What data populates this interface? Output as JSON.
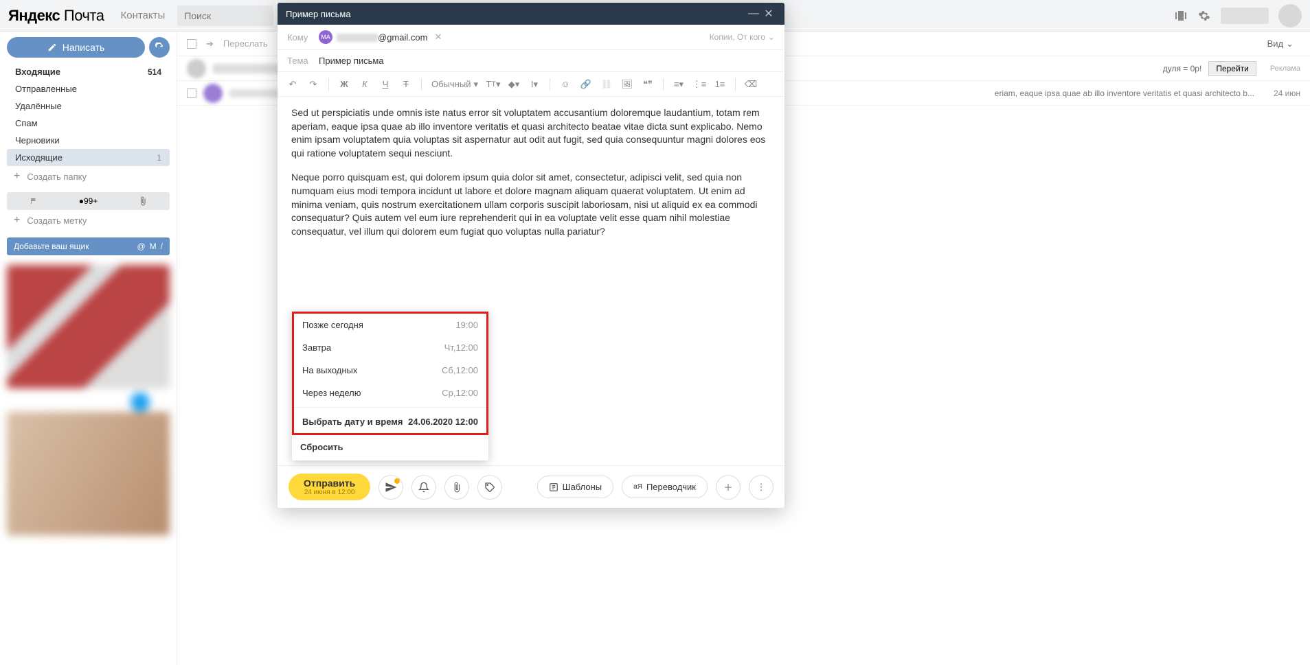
{
  "header": {
    "logo_bold": "Яндекс",
    "logo_light": "Почта",
    "contacts": "Контакты",
    "search_placeholder": "Поиск"
  },
  "sidebar": {
    "compose": "Написать",
    "folders": [
      {
        "name": "Входящие",
        "count": "514",
        "class": "inbox"
      },
      {
        "name": "Отправленные",
        "count": "",
        "class": ""
      },
      {
        "name": "Удалённые",
        "count": "",
        "class": ""
      },
      {
        "name": "Спам",
        "count": "",
        "class": ""
      },
      {
        "name": "Черновики",
        "count": "",
        "class": ""
      },
      {
        "name": "Исходящие",
        "count": "1",
        "class": "active"
      }
    ],
    "create_folder": "Создать папку",
    "bullet_count": "99+",
    "create_label": "Создать метку",
    "add_mailbox": "Добавьте ваш ящик"
  },
  "main": {
    "forward": "Переслать",
    "view": "Вид",
    "promo_text": "дуля = 0р!",
    "promo_go": "Перейти",
    "promo_ad": "Реклама",
    "row_preview": "eriam, eaque ipsa quae ab illo inventore veritatis et quasi architecto b...",
    "row_date": "24 июн"
  },
  "compose": {
    "title": "Пример письма",
    "to_label": "Кому",
    "chip_initials": "MA",
    "chip_suffix": "@gmail.com",
    "cc_toggle": "Копии, От кого",
    "subject_label": "Тема",
    "subject_value": "Пример письма",
    "style_normal": "Обычный",
    "body_p1": "Sed ut perspiciatis unde omnis iste natus error sit voluptatem accusantium doloremque laudantium, totam rem aperiam, eaque ipsa quae ab illo inventore veritatis et quasi architecto beatae vitae dicta sunt explicabo. Nemo enim ipsam voluptatem quia voluptas sit aspernatur aut odit aut fugit, sed quia consequuntur magni dolores eos qui ratione voluptatem sequi nesciunt.",
    "body_p2": "Neque porro quisquam est, qui dolorem ipsum quia dolor sit amet, consectetur, adipisci velit, sed quia non numquam eius modi tempora incidunt ut labore et dolore magnam aliquam quaerat voluptatem. Ut enim ad minima veniam, quis nostrum exercitationem ullam corporis suscipit laboriosam, nisi ut aliquid ex ea commodi consequatur? Quis autem vel eum iure reprehenderit qui in ea voluptate velit esse quam nihil molestiae consequatur, vel illum qui dolorem eum fugiat quo voluptas nulla pariatur?",
    "send": "Отправить",
    "send_sub": "24 июня в 12:00",
    "templates": "Шаблоны",
    "translator": "Переводчик"
  },
  "schedule": {
    "items": [
      {
        "label": "Позже сегодня",
        "time": "19:00"
      },
      {
        "label": "Завтра",
        "time": "Чт,12:00"
      },
      {
        "label": "На выходных",
        "time": "Сб,12:00"
      },
      {
        "label": "Через неделю",
        "time": "Ср,12:00"
      }
    ],
    "pick_label": "Выбрать дату и время",
    "pick_time": "24.06.2020 12:00",
    "reset": "Сбросить"
  }
}
